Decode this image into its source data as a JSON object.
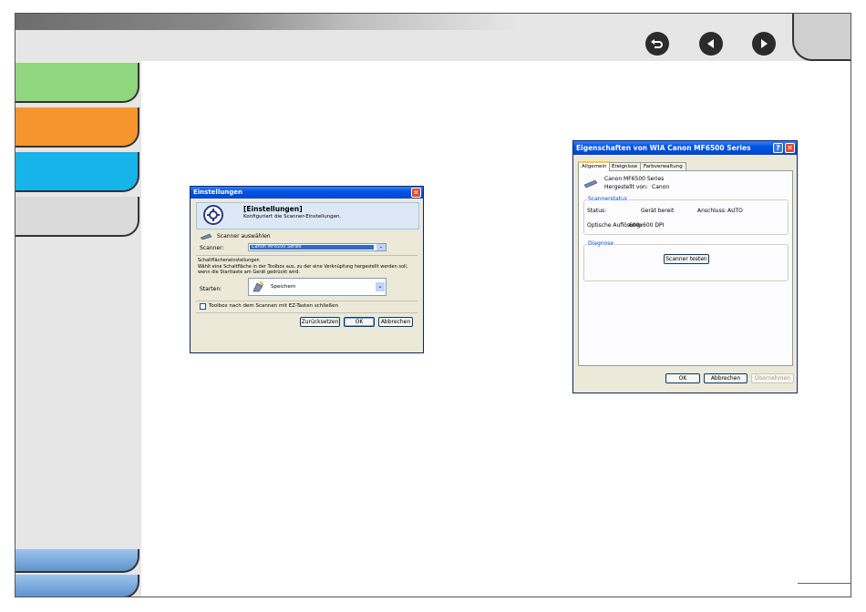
{
  "dialog1": {
    "title": "Einstellungen",
    "header_title": "[Einstellungen]",
    "header_subtitle": "Konfiguriert die Scanner-Einstellungen.",
    "scanner_select_label": "Scanner auswählen",
    "scanner_label": "Scanner:",
    "scanner_value": "Canon MF6500 Series",
    "button_settings_heading": "Schaltflächeneinstellungen",
    "button_settings_desc": "Wählt eine Schaltfläche in der Toolbox aus, zu der eine Verknüpfung hergestellt werden soll, wenn die Starttaste am Gerät gedrückt wird.",
    "start_label": "Starten:",
    "start_value": "Speichern",
    "checkbox_label": "Toolbox nach dem Scannen mit EZ-Tasten schließen",
    "reset_button": "Zurücksetzen",
    "ok_button": "OK",
    "cancel_button": "Abbrechen"
  },
  "dialog2": {
    "title": "Eigenschaften von WIA Canon MF6500 Series",
    "tabs": [
      "Allgemein",
      "Ereignisse",
      "Farbverwaltung"
    ],
    "device_name": "Canon MF6500 Series",
    "manufacturer_label": "Hergestellt von:",
    "manufacturer_value": "Canon",
    "status_group": "Scannerstatus",
    "status_label": "Status:",
    "status_value": "Gerät bereit",
    "port_label": "Anschluss:",
    "port_value": "AUTO",
    "resolution_label": "Optische Auflösung:",
    "resolution_value": "600x600 DPI",
    "diagnose_group": "Diagnose",
    "test_button": "Scanner testen",
    "ok_button": "OK",
    "cancel_button": "Abbrechen",
    "apply_button": "Übernehmen"
  },
  "icons": {
    "back": "return-arrow-icon",
    "prev": "previous-page-icon",
    "next": "next-page-icon"
  }
}
